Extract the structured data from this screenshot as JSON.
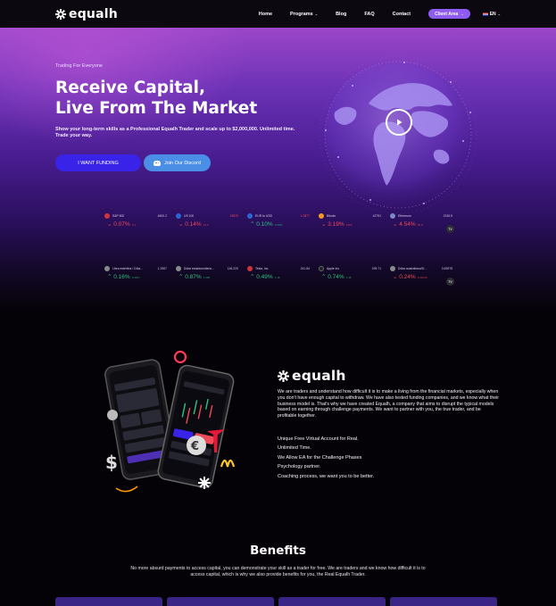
{
  "nav": {
    "logo_text": "equalh",
    "items": [
      "Home",
      "Programs",
      "Blog",
      "FAQ",
      "Contact"
    ],
    "client_area": "Client Area",
    "lang": "EN"
  },
  "hero": {
    "eyebrow": "Trading For Everyone",
    "title_line1": "Receive Capital,",
    "title_line2": "Live From The Market",
    "subtitle": "Show your long-term skills as a Professional Equalh Trader and scale up to $2,000,000. Unlimited time. Trade your way.",
    "btn_funding": "I WANT FUNDING",
    "btn_discord": "Join Our Discord"
  },
  "ticker": {
    "row1": [
      {
        "name": "S&P 500",
        "price": "4600.2",
        "change": "0.07%",
        "delta": "3.2",
        "dir": "down",
        "color": "#d0333b"
      },
      {
        "name": "US 100",
        "price": "15870",
        "change": "0.14%",
        "delta": "22.5",
        "dir": "down",
        "color": "#2a66d6"
      },
      {
        "name": "EUR to USD",
        "price": "1.0877",
        "change": "0.10%",
        "delta": "0.0011",
        "dir": "up",
        "color": "#2a66d6"
      },
      {
        "name": "Bitcoin",
        "price": "42791",
        "change": "3.19%",
        "delta": "1366",
        "dir": "down",
        "color": "#f39a1c"
      },
      {
        "name": "Ethereum",
        "price": "2245.5",
        "change": "4.54%",
        "delta": "96.8",
        "dir": "down",
        "color": "#7c86c9"
      }
    ],
    "row2": [
      {
        "name": "Libra esterlina / Dóla...",
        "price": "1.2567",
        "change": "0.16%",
        "delta": "0.0027",
        "dir": "up",
        "color": "#8a8a8a"
      },
      {
        "name": "Dólar estadounidens...",
        "price": "146.220",
        "change": "0.87%",
        "delta": "1.266",
        "dir": "up",
        "color": "#8a8a8a"
      },
      {
        "name": "Tesla, Inc.",
        "price": "241.84",
        "change": "0.49%",
        "delta": "1.18",
        "dir": "up",
        "color": "#d0333b"
      },
      {
        "name": "Apple Inc",
        "price": "195.71",
        "change": "0.74%",
        "delta": "1.45",
        "dir": "up",
        "color": "#222"
      },
      {
        "name": "Dólar australiano/D...",
        "price": "0.65978",
        "change": "0.24%",
        "delta": "0.00156",
        "dir": "down",
        "color": "#8a8a8a"
      }
    ],
    "badge": "TV"
  },
  "about": {
    "logo_text": "equalh",
    "paragraph": "We are traders and understand how difficult it is to make a living from the financial markets, especially when you don't have enough capital to withdraw. We have also tested funding companies, and we know what their business model is. That's why we have created Equalh, a company that aims to disrupt the typical models based on earning through challenge payments. We want to partner with you, the true trader, and be profitable together.",
    "features": [
      "Unique Free Virtual Account for Real.",
      "Unlimited Time.",
      "We Allow EA for the Challenge Phases",
      "Psychology partner.",
      "Coaching process, we want you to be better."
    ]
  },
  "benefits": {
    "title": "Benefits",
    "text": "No more absurd payments to access capital, you can demonstrate your skill as a trader for free. We are traders and we know how difficult it is to access capital, which is why we also provide benefits for you, the Real Equalh Trader."
  },
  "colors": {
    "up": "#2ec27e",
    "down": "#ef4b5a",
    "accent": "#8e5cf0",
    "funding_btn": "#3a23e8",
    "discord_btn": "#4b8ee6"
  }
}
